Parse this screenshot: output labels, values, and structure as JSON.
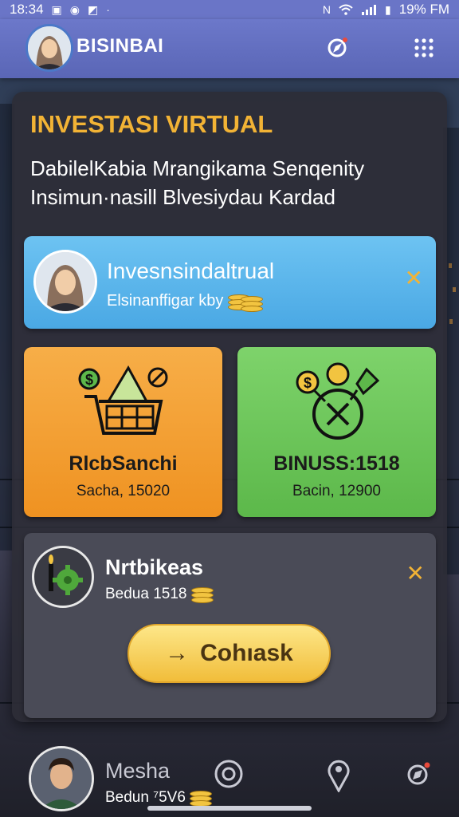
{
  "status_bar": {
    "time": "18:34",
    "battery": "19% FM",
    "left_icons": [
      "notification-icon",
      "messenger-icon",
      "gallery-icon",
      "dot-icon"
    ],
    "right_icons": [
      "nfc-icon",
      "wifi-icon",
      "signal-icon",
      "battery-icon"
    ]
  },
  "app_bar": {
    "title": "BISINBAI",
    "icons": [
      "compass-icon",
      "grid-menu-icon"
    ]
  },
  "header": {
    "title": "INVESTASI VIRTUAL",
    "subtitle_line1": "DabilelKabia Mrangikama Senqenity",
    "subtitle_line2": "Insimun·nasill Blvesiydau Kardad"
  },
  "featured_card": {
    "title": "Invesnsindaltrual",
    "subtitle": "Elsinanffigar kby",
    "close_label": "✕"
  },
  "tiles": [
    {
      "name": "RlcbSanchi",
      "value": "Sacha, 15020",
      "icon": "shopping-basket-icon"
    },
    {
      "name": "BINUSS:1518",
      "value": "Bacin, 12900",
      "icon": "crypto-cancel-icon"
    }
  ],
  "task_card": {
    "title": "Nrtbikeas",
    "subtitle": "Bedua 1518",
    "close_label": "✕",
    "button_label": "Cohıask",
    "button_arrow": "→"
  },
  "bottom_bar": {
    "name": "Mesha",
    "subtitle": "Bedun ⁷5V6",
    "icons": [
      "record-icon",
      "location-pin-icon",
      "compass-icon"
    ]
  },
  "colors": {
    "app_bar": "#6a75c7",
    "accent_gold": "#f2b335",
    "blue_card": "#5ab5ec",
    "orange_tile": "#f29a2c",
    "green_tile": "#6cc45a",
    "close_x": "#f2b335"
  }
}
